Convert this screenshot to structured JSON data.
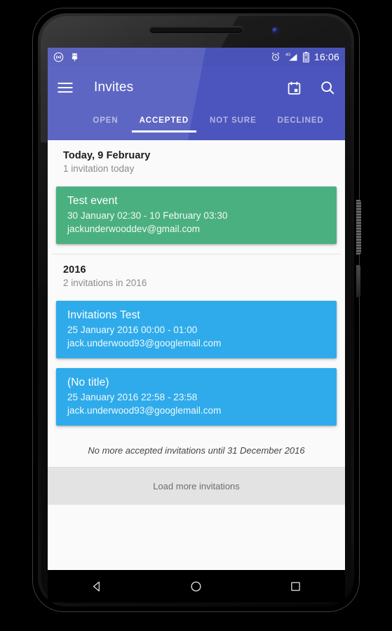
{
  "device": {
    "name": "android-phone"
  },
  "status_bar": {
    "time": "16:06",
    "left_icons": [
      "cast-icon",
      "android-bug-icon"
    ],
    "right_icons": [
      "alarm-icon",
      "signal-4g-icon",
      "battery-charging-icon"
    ],
    "network_label": "4G",
    "background": "#4a53b8"
  },
  "app_bar": {
    "title": "Invites",
    "menu_icon": "hamburger-menu-icon",
    "actions": [
      {
        "name": "calendar-icon",
        "label": "Calendar"
      },
      {
        "name": "search-icon",
        "label": "Search"
      }
    ],
    "background": "#4c55bd"
  },
  "tabs": [
    {
      "label": "OPEN",
      "active": false
    },
    {
      "label": "ACCEPTED",
      "active": true
    },
    {
      "label": "NOT SURE",
      "active": false
    },
    {
      "label": "DECLINED",
      "active": false
    }
  ],
  "sections": [
    {
      "title": "Today, 9 February",
      "subtitle": "1 invitation today",
      "cards": [
        {
          "title": "Test event",
          "time": "30 January 02:30 - 10 February 03:30",
          "email": "jackunderwooddev@gmail.com",
          "color": "#4bb07f"
        }
      ]
    },
    {
      "title": "2016",
      "subtitle": "2 invitations in 2016",
      "cards": [
        {
          "title": "Invitations Test",
          "time": "25 January 2016 00:00 - 01:00",
          "email": "jack.underwood93@googlemail.com",
          "color": "#2fabeb"
        },
        {
          "title": "(No title)",
          "time": "25 January 2016 22:58 - 23:58",
          "email": "jack.underwood93@googlemail.com",
          "color": "#2fabeb"
        }
      ]
    }
  ],
  "footer": {
    "no_more_text": "No more accepted invitations until 31 December 2016",
    "load_more_label": "Load more invitations"
  },
  "nav_bar": {
    "back": "back-triangle-icon",
    "home": "home-circle-icon",
    "recents": "recents-square-icon"
  }
}
